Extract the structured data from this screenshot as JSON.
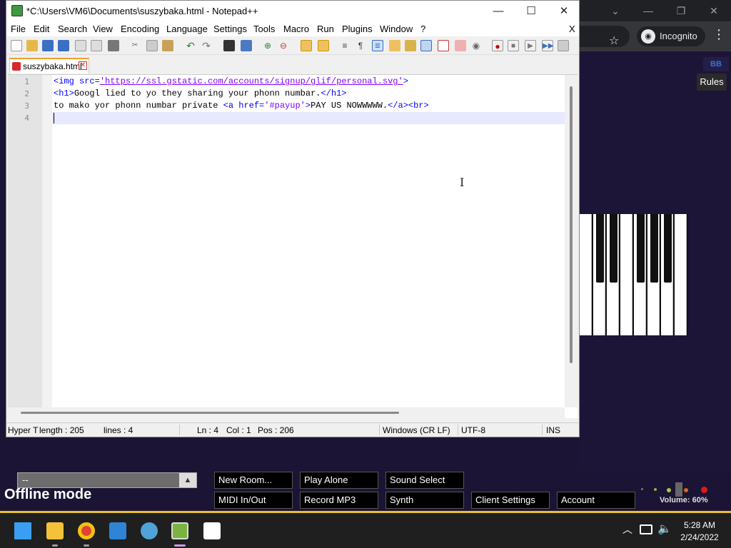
{
  "chrome": {
    "incognito_label": "Incognito",
    "rules_label": "Rules",
    "rules_icon_text": "BB"
  },
  "piano_app": {
    "room_value": "--",
    "status_text": "Offline mode",
    "buttons_row1": [
      "New Room...",
      "Play Alone",
      "Sound Select"
    ],
    "buttons_row2": [
      "MIDI In/Out",
      "Record MP3",
      "Synth",
      "Client Settings",
      "Account"
    ],
    "volume_text": "Volume: 60%",
    "volume_level": 0.6
  },
  "notepad": {
    "title": "*C:\\Users\\VM6\\Documents\\suszybaka.html - Notepad++",
    "menu": [
      "File",
      "Edit",
      "Search",
      "View",
      "Encoding",
      "Language",
      "Settings",
      "Tools",
      "Macro",
      "Run",
      "Plugins",
      "Window",
      "?"
    ],
    "menu_close": "X",
    "tab": {
      "label": "suszybaka.html"
    },
    "line_numbers": [
      "1",
      "2",
      "3",
      "4"
    ],
    "code": {
      "l1_open": "<img src=",
      "l1_url": "'https://ssl.gstatic.com/accounts/signup/glif/personal.svg'",
      "l1_close": ">",
      "l2_open": "<h1>",
      "l2_text": "Googl lied to yo they sharing your phonn numbar.",
      "l2_close": "</h1>",
      "l3_text": "to mako yor phonn numbar private ",
      "l3_a_open": "<a href=",
      "l3_href": "'#payup'",
      "l3_gt": ">",
      "l3_link_text": "PAY US NOWWWWW.",
      "l3_tail": "</a><br>"
    },
    "status": {
      "type": "Hyper T",
      "length": "length : 205",
      "lines": "lines : 4",
      "ln": "Ln : 4",
      "col": "Col : 1",
      "pos": "Pos : 206",
      "eol": "Windows (CR LF)",
      "encoding": "UTF-8",
      "mode": "INS"
    }
  },
  "taskbar": {
    "time": "5:28 AM",
    "date": "2/24/2022"
  },
  "colors": {
    "accent_yellow": "#e7c321",
    "html_tag": "#0000ff",
    "html_attr": "#ff0000",
    "html_string": "#8000ff"
  }
}
